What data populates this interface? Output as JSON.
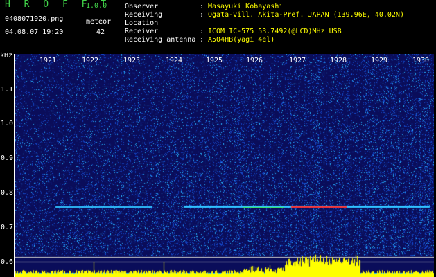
{
  "header": {
    "app_name": "H R O F F T",
    "app_version": "1.0.0",
    "file_name": "0408071920.png",
    "meteor_label": "meteor",
    "datetime": "04.08.07 19:20",
    "meteor_count": "42",
    "fields": [
      {
        "label": "Observer",
        "sep": ":",
        "value": "Masayuki Kobayashi"
      },
      {
        "label": "Receiving Location",
        "sep": ":",
        "value": "Ogata-vill. Akita-Pref. JAPAN (139.96E, 40.02N)"
      },
      {
        "label": "Receiver",
        "sep": ":",
        "value": "ICOM IC-575 53.7492(@LCD)MHz USB"
      },
      {
        "label": "Receiving antenna",
        "sep": ":",
        "value": "A504HB(yagi 4el)"
      }
    ]
  },
  "spectrogram": {
    "freq_unit": "kHz",
    "x_ticks": [
      "1921",
      "1922",
      "1923",
      "1924",
      "1925",
      "1926",
      "1927",
      "1928",
      "1929",
      "1930"
    ],
    "y_ticks": [
      "1.1",
      "1.0",
      "0.9",
      "0.8",
      "0.7",
      "0.6"
    ],
    "colors": {
      "background": "#0a0d5a",
      "signal_low": "#2040c0",
      "signal_mid": "#30c0ff",
      "echo": "#ff3030",
      "bar": "#ffff00",
      "bar_base": "#30d0ff",
      "text_green": "#42d64a",
      "text_yellow": "#ffff00"
    }
  }
}
